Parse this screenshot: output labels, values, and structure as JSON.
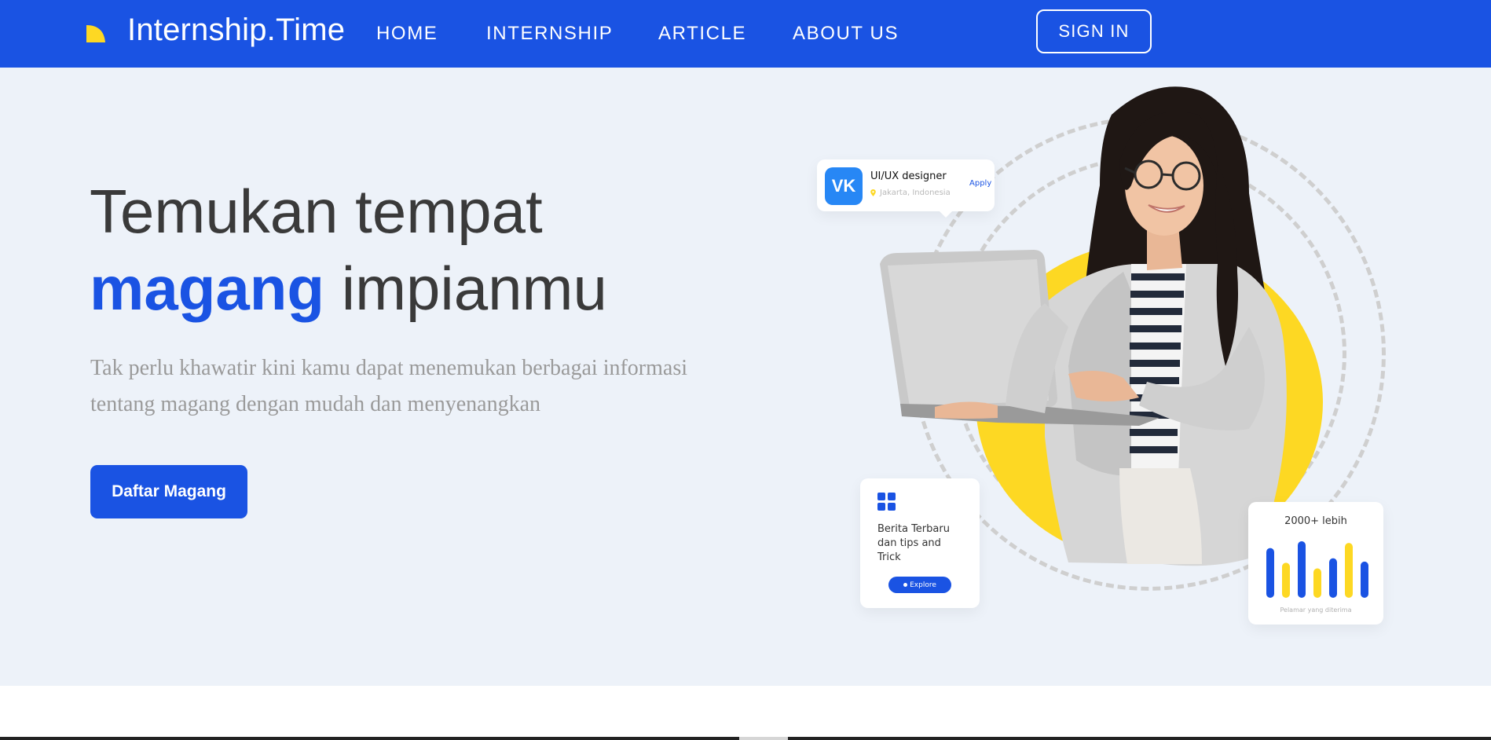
{
  "brand": {
    "name": "Internship.Time",
    "mark_color": "#fdd823",
    "primary_color": "#1a53e3"
  },
  "nav": {
    "items": [
      {
        "label": "HOME"
      },
      {
        "label": "INTERNSHIP"
      },
      {
        "label": "ARTICLE"
      },
      {
        "label": "ABOUT US"
      }
    ],
    "signin_label": "SIGN IN"
  },
  "hero": {
    "title_line1": "Temukan tempat",
    "title_accent": "magang",
    "title_rest": " impianmu",
    "subtitle": "Tak perlu khawatir kini kamu dapat menemukan berbagai informasi tentang magang dengan mudah dan menyenangkan",
    "cta_label": "Daftar Magang"
  },
  "illustration": {
    "job_card": {
      "logo_text": "VK",
      "title": "UI/UX designer",
      "location": "Jakarta, Indonesia",
      "apply_label": "Apply"
    },
    "news_card": {
      "icon": "grid-icon",
      "title": "Berita Terbaru dan tips and Trick",
      "button_label": "Explore"
    },
    "stat_card": {
      "title": "2000+ lebih",
      "caption": "Pelamar yang diterima",
      "bars": [
        {
          "value": 0.88,
          "color": "#1a53e3"
        },
        {
          "value": 0.62,
          "color": "#fdd823"
        },
        {
          "value": 1.0,
          "color": "#1a53e3"
        },
        {
          "value": 0.52,
          "color": "#fdd823"
        },
        {
          "value": 0.7,
          "color": "#1a53e3"
        },
        {
          "value": 0.97,
          "color": "#fdd823"
        },
        {
          "value": 0.64,
          "color": "#1a53e3"
        }
      ]
    }
  }
}
